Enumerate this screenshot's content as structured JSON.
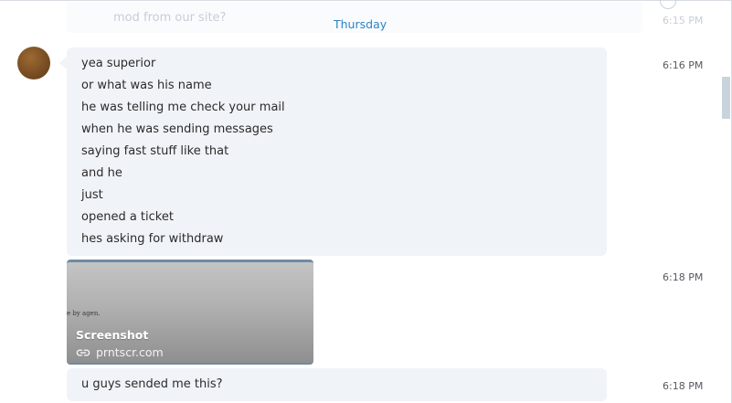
{
  "previous_message": {
    "text": "mod from our site?",
    "time": "6:15 PM"
  },
  "day_divider": "Thursday",
  "messages": [
    {
      "time": "6:16 PM",
      "lines": [
        "yea superior",
        "or what was his name",
        "he was telling me check your mail",
        "when he was sending messages",
        "saying fast stuff like that",
        "and he",
        "just",
        "opened a ticket",
        "hes asking for withdraw"
      ]
    },
    {
      "time": "6:18 PM",
      "link_preview": {
        "image_text": "e by agen.",
        "title": "Screenshot",
        "domain": "prntscr.com",
        "icon": "link-icon"
      }
    },
    {
      "time": "6:18 PM",
      "lines": [
        "u guys sended me this?"
      ]
    }
  ],
  "colors": {
    "divider_text": "#2a84c6",
    "bubble_background": "#f0f3f8",
    "scrollbar_thumb": "#c9d3dc"
  }
}
